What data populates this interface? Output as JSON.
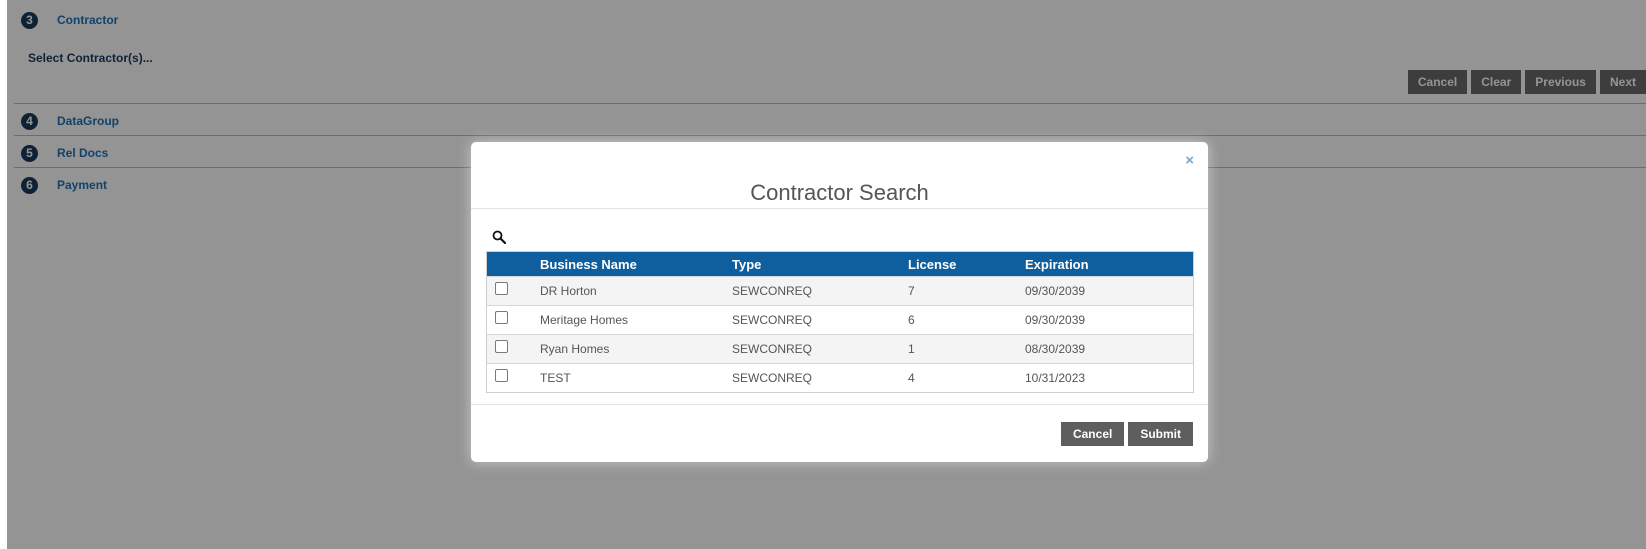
{
  "steps": [
    {
      "number": "3",
      "label": "Contractor"
    },
    {
      "number": "4",
      "label": "DataGroup"
    },
    {
      "number": "5",
      "label": "Rel Docs"
    },
    {
      "number": "6",
      "label": "Payment"
    }
  ],
  "contractor_section": {
    "select_text": "Select Contractor(s)...",
    "buttons": {
      "cancel": "Cancel",
      "clear": "Clear",
      "previous": "Previous",
      "next": "Next"
    }
  },
  "modal": {
    "close_label": "×",
    "title": "Contractor Search",
    "columns": [
      "Business Name",
      "Type",
      "License",
      "Expiration"
    ],
    "rows": [
      {
        "name": "DR Horton",
        "type": "SEWCONREQ",
        "license": "7",
        "expiration": "09/30/2039"
      },
      {
        "name": "Meritage Homes",
        "type": "SEWCONREQ",
        "license": "6",
        "expiration": "09/30/2039"
      },
      {
        "name": "Ryan Homes",
        "type": "SEWCONREQ",
        "license": "1",
        "expiration": "08/30/2039"
      },
      {
        "name": "TEST",
        "type": "SEWCONREQ",
        "license": "4",
        "expiration": "10/31/2023"
      }
    ],
    "footer": {
      "cancel": "Cancel",
      "submit": "Submit"
    }
  },
  "colors": {
    "header_blue": "#0f5f9e",
    "link_blue": "#1f73b7",
    "button_gray": "#6a6a6a"
  },
  "icons": {
    "search": "magnifier-icon"
  }
}
